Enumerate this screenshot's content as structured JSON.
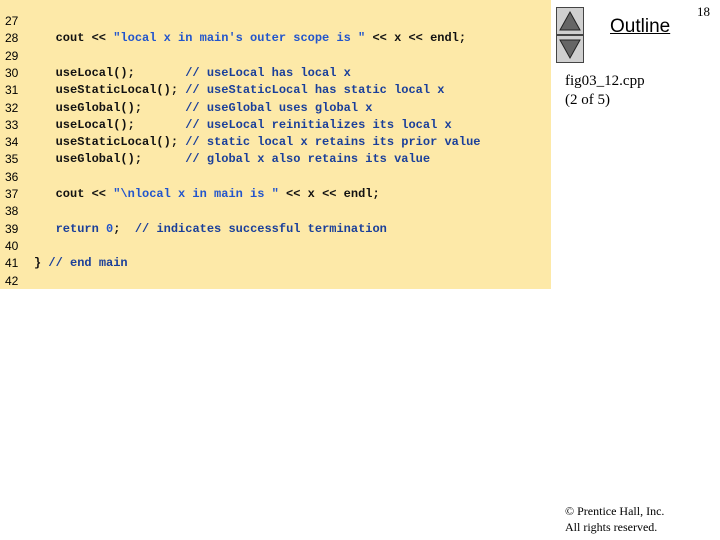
{
  "slide": {
    "number": "18",
    "outline_label": "Outline",
    "fig_name": "fig03_12.cpp",
    "fig_part": "(2 of 5)",
    "copyright_line1": "© Prentice Hall, Inc.",
    "copyright_line2": "All rights reserved."
  },
  "nav": {
    "up_icon": "triangle-up-icon",
    "down_icon": "triangle-down-icon"
  },
  "code_lines": [
    {
      "num": "27",
      "tokens": []
    },
    {
      "num": "28",
      "tokens": [
        {
          "t": "   cout << ",
          "c": ""
        },
        {
          "t": "\"local x in main's outer scope is \"",
          "c": "str"
        },
        {
          "t": " << x << endl;",
          "c": ""
        }
      ]
    },
    {
      "num": "29",
      "tokens": []
    },
    {
      "num": "30",
      "tokens": [
        {
          "t": "   useLocal();       ",
          "c": ""
        },
        {
          "t": "// useLocal has local x",
          "c": "cm"
        }
      ]
    },
    {
      "num": "31",
      "tokens": [
        {
          "t": "   useStaticLocal(); ",
          "c": ""
        },
        {
          "t": "// useStaticLocal has static local x",
          "c": "cm"
        }
      ]
    },
    {
      "num": "32",
      "tokens": [
        {
          "t": "   useGlobal();      ",
          "c": ""
        },
        {
          "t": "// useGlobal uses global x",
          "c": "cm"
        }
      ]
    },
    {
      "num": "33",
      "tokens": [
        {
          "t": "   useLocal();       ",
          "c": ""
        },
        {
          "t": "// useLocal reinitializes its local x",
          "c": "cm"
        }
      ]
    },
    {
      "num": "34",
      "tokens": [
        {
          "t": "   useStaticLocal(); ",
          "c": ""
        },
        {
          "t": "// static local x retains its prior value",
          "c": "cm"
        }
      ]
    },
    {
      "num": "35",
      "tokens": [
        {
          "t": "   useGlobal();      ",
          "c": ""
        },
        {
          "t": "// global x also retains its value",
          "c": "cm"
        }
      ]
    },
    {
      "num": "36",
      "tokens": []
    },
    {
      "num": "37",
      "tokens": [
        {
          "t": "   cout << ",
          "c": ""
        },
        {
          "t": "\"\\nlocal x in main is \"",
          "c": "str"
        },
        {
          "t": " << x << endl;",
          "c": ""
        }
      ]
    },
    {
      "num": "38",
      "tokens": []
    },
    {
      "num": "39",
      "tokens": [
        {
          "t": "   ",
          "c": ""
        },
        {
          "t": "return",
          "c": "kw"
        },
        {
          "t": " ",
          "c": ""
        },
        {
          "t": "0",
          "c": "num"
        },
        {
          "t": ";  ",
          "c": ""
        },
        {
          "t": "// indicates successful termination",
          "c": "cm"
        }
      ]
    },
    {
      "num": "40",
      "tokens": []
    },
    {
      "num": "41",
      "tokens": [
        {
          "t": "} ",
          "c": ""
        },
        {
          "t": "// end main",
          "c": "cm"
        }
      ]
    },
    {
      "num": "42",
      "tokens": []
    }
  ],
  "colors": {
    "code_background": "#fde9a8",
    "string_color": "#2255cc",
    "comment_color": "#1a3f9a"
  }
}
